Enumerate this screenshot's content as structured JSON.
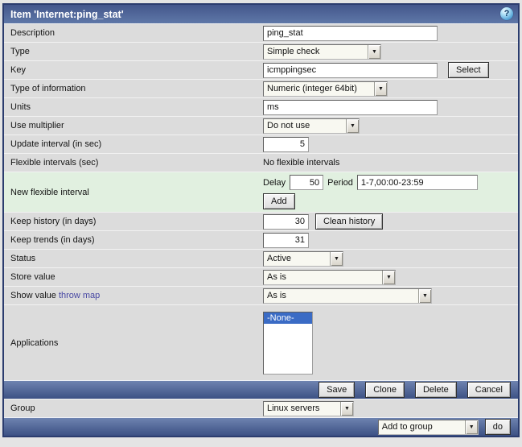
{
  "header": {
    "title": "Item 'Internet:ping_stat'",
    "help_icon": "?"
  },
  "fields": {
    "description": {
      "label": "Description",
      "value": "ping_stat"
    },
    "type": {
      "label": "Type",
      "value": "Simple check"
    },
    "key": {
      "label": "Key",
      "value": "icmppingsec",
      "button": "Select"
    },
    "type_of_information": {
      "label": "Type of information",
      "value": "Numeric (integer 64bit)"
    },
    "units": {
      "label": "Units",
      "value": "ms"
    },
    "use_multiplier": {
      "label": "Use multiplier",
      "value": "Do not use"
    },
    "update_interval": {
      "label": "Update interval (in sec)",
      "value": "5"
    },
    "flexible_intervals": {
      "label": "Flexible intervals (sec)",
      "value": "No flexible intervals"
    },
    "new_flexible_interval": {
      "label": "New flexible interval",
      "delay_label": "Delay",
      "delay_value": "50",
      "period_label": "Period",
      "period_value": "1-7,00:00-23:59",
      "add_button": "Add"
    },
    "keep_history": {
      "label": "Keep history (in days)",
      "value": "30",
      "button": "Clean history"
    },
    "keep_trends": {
      "label": "Keep trends (in days)",
      "value": "31"
    },
    "status": {
      "label": "Status",
      "value": "Active"
    },
    "store_value": {
      "label": "Store value",
      "value": "As is"
    },
    "show_value": {
      "label_prefix": "Show value",
      "link": "throw map",
      "value": "As is"
    },
    "applications": {
      "label": "Applications",
      "options": [
        "-None-"
      ]
    }
  },
  "actions": {
    "save": "Save",
    "clone": "Clone",
    "delete": "Delete",
    "cancel": "Cancel"
  },
  "group": {
    "label": "Group",
    "value": "Linux servers"
  },
  "footer": {
    "action_value": "Add to group",
    "do_button": "do"
  },
  "colors": {
    "header_blue": "#4b6092",
    "bar_blue": "#52679a",
    "row_gray": "#dcdcdc",
    "new_interval_green": "#e1f0e0",
    "selection_blue": "#3a6bc5",
    "border_navy": "#2b3c6e",
    "link_purple": "#4747a3"
  }
}
